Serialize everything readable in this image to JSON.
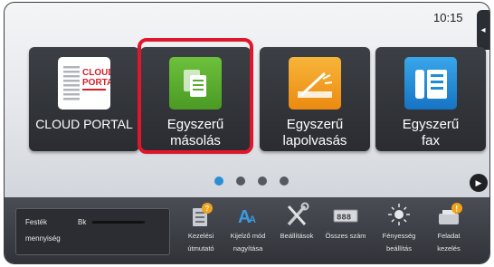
{
  "status": {
    "time": "10:15"
  },
  "side_tab_glyph": "◂",
  "tiles": [
    {
      "label": "CLOUD PORTAL",
      "logo_text": [
        "CLOUD",
        "PORTAL"
      ],
      "selected": false
    },
    {
      "label_lines": [
        "Egyszerű",
        "másolás"
      ],
      "icon": "copy-icon",
      "icon_color": "#5aab2f",
      "selected": true
    },
    {
      "label_lines": [
        "Egyszerű",
        "lapolvasás"
      ],
      "icon": "scanner-icon",
      "icon_color": "#f29a1a",
      "selected": false
    },
    {
      "label_lines": [
        "Egyszerű",
        "fax"
      ],
      "icon": "fax-icon",
      "icon_color": "#1f8dd6",
      "selected": false
    }
  ],
  "pagination": {
    "pages": 4,
    "active_index": 0
  },
  "next_glyph": "▶",
  "toner": {
    "label_lines": [
      "Festék",
      "mennyiség"
    ],
    "color_label": "Bk",
    "level": 0.95
  },
  "shortcuts": [
    {
      "icon": "operation-guide-icon",
      "label_lines": [
        "Kezelési",
        "útmutató"
      ]
    },
    {
      "icon": "display-mode-icon",
      "icon_text": "A",
      "label_lines": [
        "Kijelző mód",
        "nagyítása"
      ]
    },
    {
      "icon": "settings-tools-icon",
      "label_lines": [
        "Beállítások",
        ""
      ]
    },
    {
      "icon": "total-count-icon",
      "icon_text": "888",
      "label_lines": [
        "Összes szám",
        ""
      ]
    },
    {
      "icon": "brightness-icon",
      "label_lines": [
        "Fényesség",
        "beállítás"
      ]
    },
    {
      "icon": "job-status-icon",
      "label_lines": [
        "Feladat",
        "kezelés"
      ]
    }
  ],
  "colors": {
    "selection": "#e0162b",
    "dot_active": "#2c8fd6",
    "cloud_logo": "#d4202a"
  }
}
